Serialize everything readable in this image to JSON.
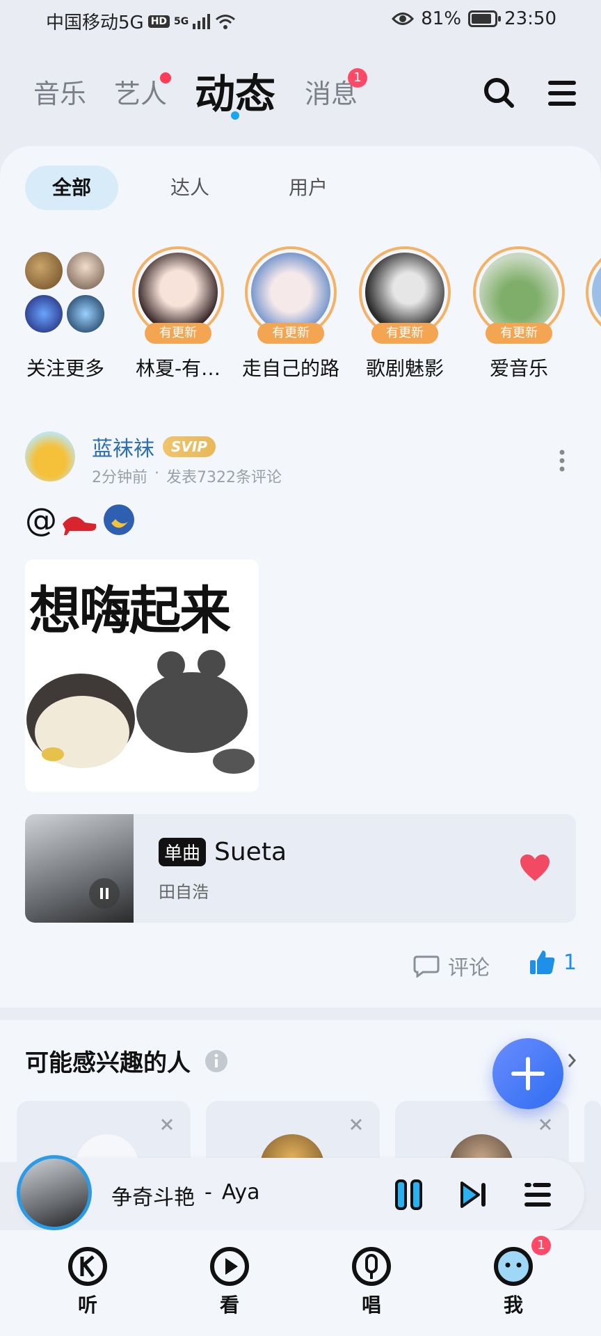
{
  "status_bar": {
    "carrier": "中国移动5G",
    "hd": "HD",
    "net": "5G",
    "battery_pct": "81%",
    "battery_level": 0.81,
    "time": "23:50"
  },
  "top_nav": {
    "tabs": [
      {
        "label": "音乐"
      },
      {
        "label": "艺人"
      },
      {
        "label": "动态"
      },
      {
        "label": "消息",
        "badge": "1"
      }
    ],
    "active": "动态"
  },
  "segments": [
    {
      "label": "全部"
    },
    {
      "label": "达人"
    },
    {
      "label": "用户"
    }
  ],
  "follow_row": {
    "more_label": "关注更多",
    "update_tag": "有更新",
    "users": [
      {
        "name": "林夏-有…"
      },
      {
        "name": "走自己的路"
      },
      {
        "name": "歌剧魅影"
      },
      {
        "name": "爱音乐"
      }
    ]
  },
  "post": {
    "author": "蓝袜袜",
    "vip": "SVIP",
    "time": "2分钟前",
    "sep": "·",
    "meta": "发表7322条评论",
    "text": "@",
    "image_caption": "想嗨起来",
    "song": {
      "tag": "单曲",
      "title": "Sueta",
      "artist": "田自浩"
    },
    "comment_label": "评论",
    "like_count": "1"
  },
  "suggest": {
    "title": "可能感兴趣的人"
  },
  "player": {
    "song": "争奇斗艳",
    "sep": "-",
    "artist": "Aya"
  },
  "bottom_nav": [
    {
      "label": "听"
    },
    {
      "label": "看"
    },
    {
      "label": "唱"
    },
    {
      "label": "我",
      "badge": "1"
    }
  ],
  "colors": {
    "accent": "#19a6f0",
    "update": "#f4a551",
    "badge": "#ff4966",
    "heart": "#f24a63",
    "like": "#1e90e8"
  }
}
